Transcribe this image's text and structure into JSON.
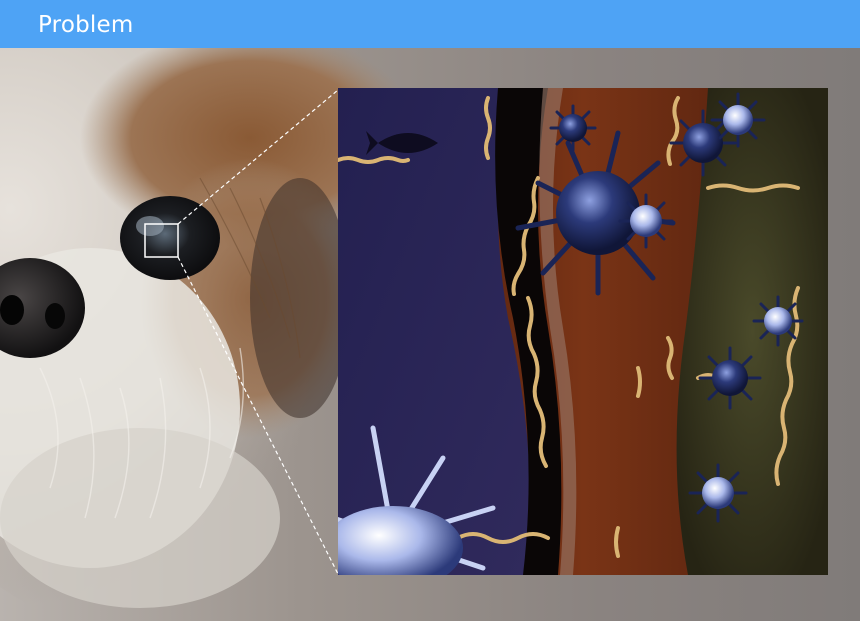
{
  "header": {
    "title": "Problem"
  },
  "colors": {
    "header_bar": "#4ea3f5",
    "header_text": "#ffffff",
    "callout_line": "#ffffff",
    "background_gray": "#8a8582",
    "fluid_navy": "#2a2452",
    "tissue_rust": "#6a2a12",
    "bacteria_tan": "#d9b473",
    "virus_blue": "#2c3a7a"
  },
  "icons": [
    "magnify-callout",
    "dog-eye-photo",
    "virus-illustration",
    "bacteria-illustration"
  ]
}
